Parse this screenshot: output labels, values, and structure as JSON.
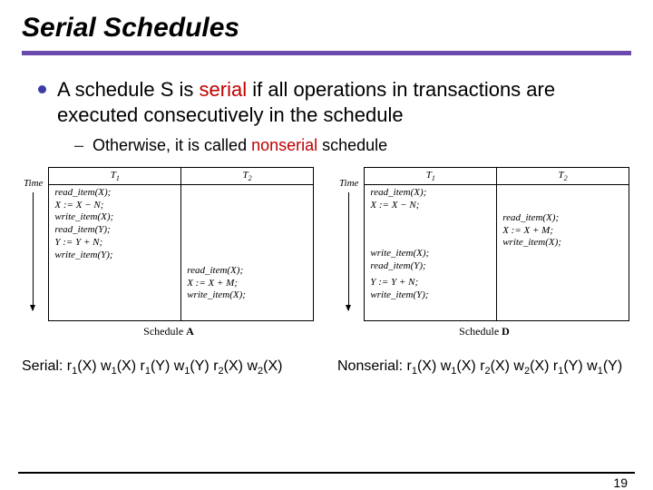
{
  "title": "Serial Schedules",
  "bullet1": {
    "pre": "A schedule S is ",
    "em": "serial",
    "post": " if all operations in transactions are executed consecutively in the schedule"
  },
  "bullet2": {
    "pre": "Otherwise, it is called ",
    "em": "nonserial",
    "post": " schedule"
  },
  "figA": {
    "time": "Time",
    "h1": "T",
    "h1sub": "1",
    "h2": "T",
    "h2sub": "2",
    "ops_t1": "read_item(X);\nX := X − N;\nwrite_item(X);\nread_item(Y);\nY := Y + N;\nwrite_item(Y);",
    "ops_t2": "read_item(X);\nX := X + M;\nwrite_item(X);",
    "caption_prefix": "Schedule ",
    "caption_label": "A"
  },
  "figD": {
    "time": "Time",
    "h1": "T",
    "h1sub": "1",
    "h2": "T",
    "h2sub": "2",
    "ops_t1a": "read_item(X);\nX := X − N;",
    "ops_t2": "read_item(X);\nX := X + M;\nwrite_item(X);",
    "ops_t1b": "write_item(X);\nread_item(Y);",
    "ops_t1c": "Y := Y + N;\nwrite_item(Y);",
    "caption_prefix": "Schedule ",
    "caption_label": "D"
  },
  "bottom": {
    "serial_label": "Serial: ",
    "serial_ops": [
      {
        "p": "r",
        "s": "1",
        "a": "(X) "
      },
      {
        "p": "w",
        "s": "1",
        "a": "(X) "
      },
      {
        "p": "r",
        "s": "1",
        "a": "(Y) "
      },
      {
        "p": "w",
        "s": "1",
        "a": "(Y) "
      },
      {
        "p": "r",
        "s": "2",
        "a": "(X) "
      },
      {
        "p": "w",
        "s": "2",
        "a": "(X)"
      }
    ],
    "nonserial_label": "Nonserial: ",
    "nonserial_ops": [
      {
        "p": "r",
        "s": "1",
        "a": "(X) "
      },
      {
        "p": "w",
        "s": "1",
        "a": "(X) "
      },
      {
        "p": "r",
        "s": "2",
        "a": "(X) "
      },
      {
        "p": "w",
        "s": "2",
        "a": "(X) "
      },
      {
        "p": "r",
        "s": "1",
        "a": "(Y) "
      },
      {
        "p": "w",
        "s": "1",
        "a": "(Y)"
      }
    ]
  },
  "page_number": "19"
}
